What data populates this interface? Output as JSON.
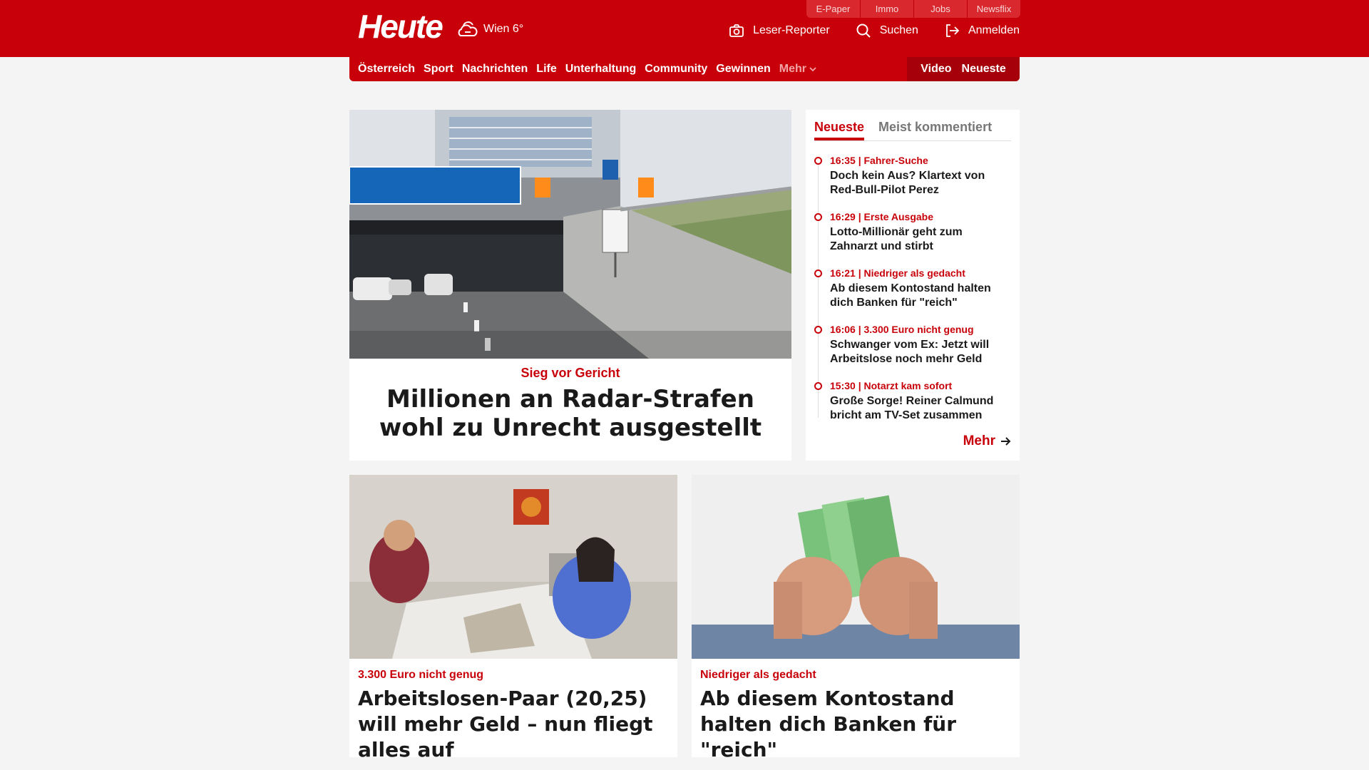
{
  "header": {
    "logo": "Heute",
    "weather": "Wien 6°",
    "topbar": [
      "E-Paper",
      "Immo",
      "Jobs",
      "Newsflix"
    ],
    "actions": {
      "reporter": "Leser-Reporter",
      "search": "Suchen",
      "login": "Anmelden"
    }
  },
  "nav": {
    "items": [
      "Österreich",
      "Sport",
      "Nachrichten",
      "Life",
      "Unterhaltung",
      "Community",
      "Gewinnen"
    ],
    "more": "Mehr",
    "video": "Video",
    "newest": "Neueste"
  },
  "hero": {
    "kicker": "Sieg vor Gericht",
    "title": "Millionen an Radar-Strafen wohl zu Unrecht ausgestellt"
  },
  "sidebar": {
    "tabs": [
      "Neueste",
      "Meist kommentiert"
    ],
    "items": [
      {
        "meta": "16:35 | Fahrer-Suche",
        "title": "Doch kein Aus? Klartext von Red-Bull-Pilot Perez"
      },
      {
        "meta": "16:29 | Erste Ausgabe",
        "title": "Lotto-Millionär geht zum Zahnarzt und stirbt"
      },
      {
        "meta": "16:21 | Niedriger als gedacht",
        "title": "Ab diesem Kontostand halten dich Banken für \"reich\""
      },
      {
        "meta": "16:06 | 3.300 Euro nicht genug",
        "title": "Schwanger vom Ex: Jetzt will Arbeitslose noch mehr Geld"
      },
      {
        "meta": "15:30 | Notarzt kam sofort",
        "title": "Große Sorge! Reiner Calmund bricht am TV-Set zusammen"
      }
    ],
    "more": "Mehr"
  },
  "cards": [
    {
      "kicker": "3.300 Euro nicht genug",
      "title": "Arbeitslosen-Paar (20,25) will mehr Geld – nun fliegt alles auf"
    },
    {
      "kicker": "Niedriger als gedacht",
      "title": "Ab diesem Kontostand halten dich Banken für \"reich\""
    }
  ]
}
